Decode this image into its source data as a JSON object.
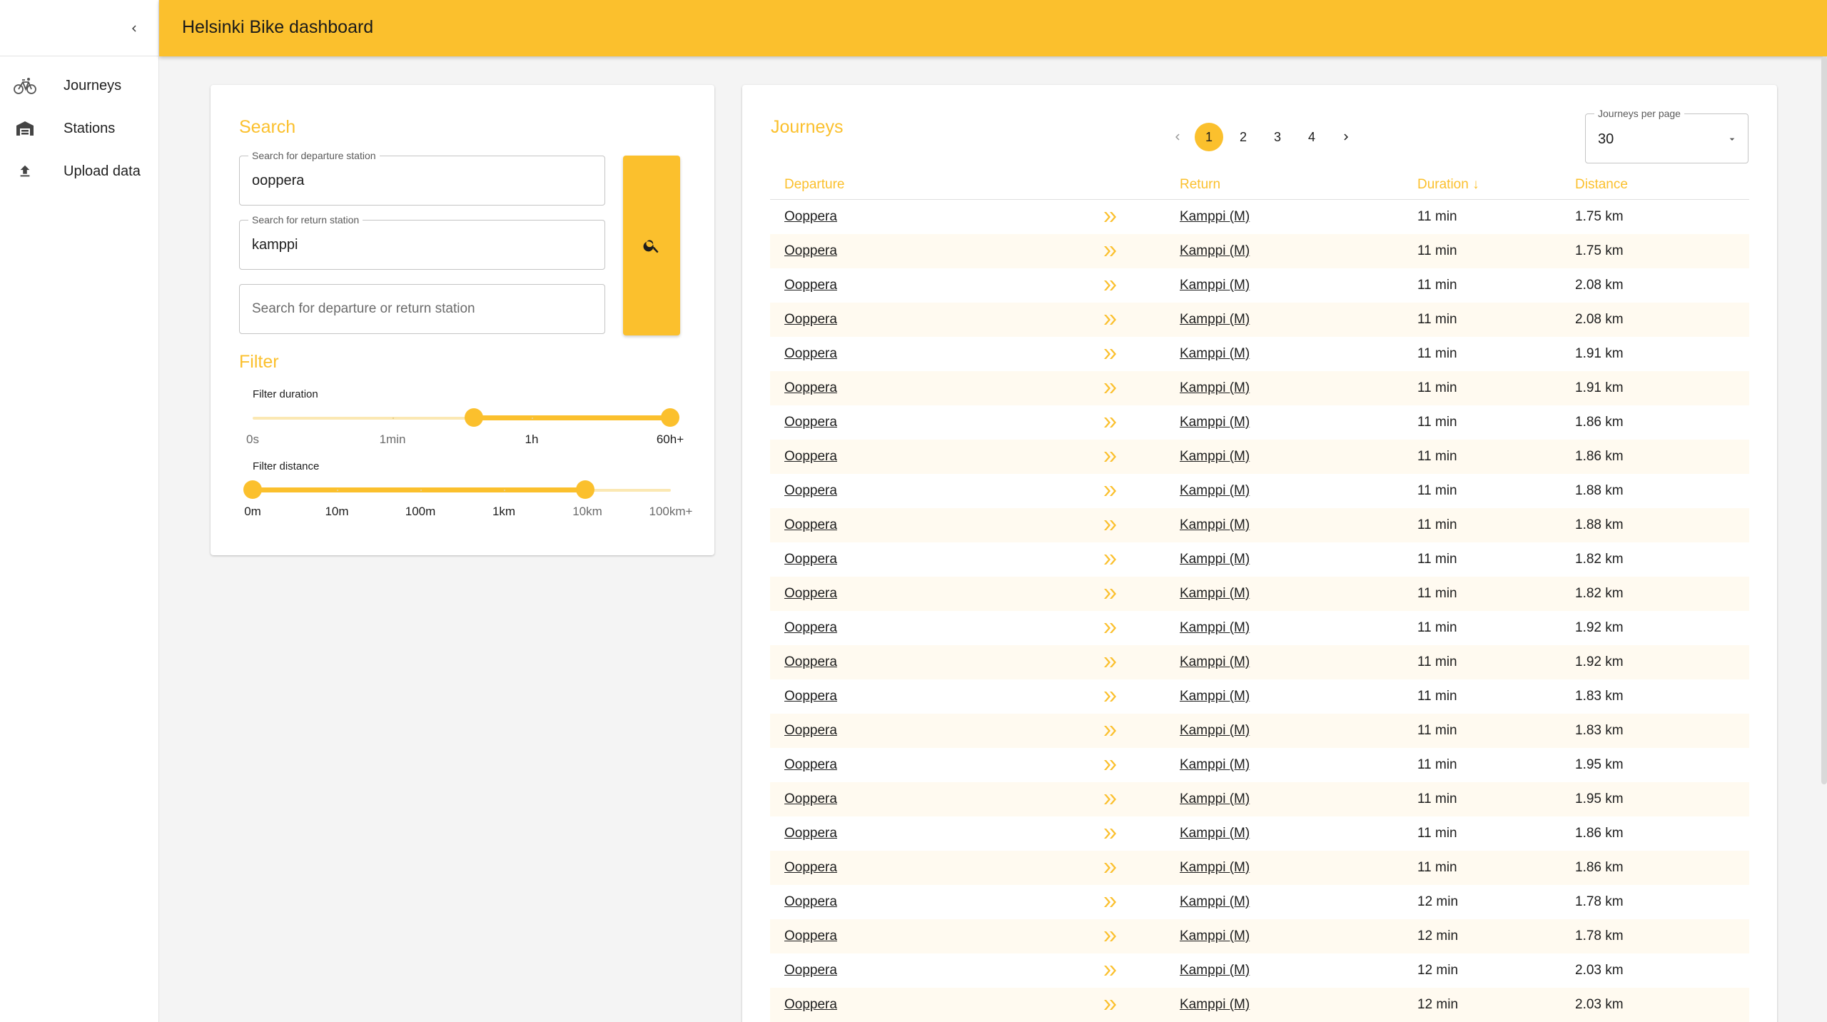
{
  "app": {
    "title": "Helsinki Bike dashboard"
  },
  "sidebar": {
    "collapse_icon": "chevron-left-icon",
    "items": [
      {
        "label": "Journeys",
        "icon": "bicycle-icon"
      },
      {
        "label": "Stations",
        "icon": "warehouse-icon"
      },
      {
        "label": "Upload data",
        "icon": "upload-icon"
      }
    ]
  },
  "search": {
    "title": "Search",
    "departure": {
      "legend": "Search for departure station",
      "value": "ooppera"
    },
    "return": {
      "legend": "Search for return station",
      "value": "kamppi"
    },
    "either": {
      "placeholder": "Search for departure or return station"
    },
    "button_icon": "search-icon"
  },
  "filter": {
    "title": "Filter",
    "duration": {
      "label": "Filter duration",
      "marks": [
        "0s",
        "1min",
        "1h",
        "60h+"
      ],
      "selected_range": [
        "1h (approx. 0.5 of scale)",
        "60h+"
      ]
    },
    "distance": {
      "label": "Filter distance",
      "marks": [
        "0m",
        "10m",
        "100m",
        "1km",
        "10km",
        "100km+"
      ],
      "selected_range": [
        "0m",
        "10km"
      ]
    }
  },
  "journeys": {
    "title": "Journeys",
    "pagination": {
      "pages": [
        "1",
        "2",
        "3",
        "4"
      ],
      "current": "1"
    },
    "per_page": {
      "legend": "Journeys per page",
      "value": "30"
    },
    "columns": {
      "departure": "Departure",
      "return": "Return",
      "duration": "Duration ↓",
      "distance": "Distance"
    },
    "rows": [
      {
        "departure": "Ooppera",
        "return": "Kamppi (M)",
        "duration": "11 min",
        "distance": "1.75 km"
      },
      {
        "departure": "Ooppera",
        "return": "Kamppi (M)",
        "duration": "11 min",
        "distance": "1.75 km"
      },
      {
        "departure": "Ooppera",
        "return": "Kamppi (M)",
        "duration": "11 min",
        "distance": "2.08 km"
      },
      {
        "departure": "Ooppera",
        "return": "Kamppi (M)",
        "duration": "11 min",
        "distance": "2.08 km"
      },
      {
        "departure": "Ooppera",
        "return": "Kamppi (M)",
        "duration": "11 min",
        "distance": "1.91 km"
      },
      {
        "departure": "Ooppera",
        "return": "Kamppi (M)",
        "duration": "11 min",
        "distance": "1.91 km"
      },
      {
        "departure": "Ooppera",
        "return": "Kamppi (M)",
        "duration": "11 min",
        "distance": "1.86 km"
      },
      {
        "departure": "Ooppera",
        "return": "Kamppi (M)",
        "duration": "11 min",
        "distance": "1.86 km"
      },
      {
        "departure": "Ooppera",
        "return": "Kamppi (M)",
        "duration": "11 min",
        "distance": "1.88 km"
      },
      {
        "departure": "Ooppera",
        "return": "Kamppi (M)",
        "duration": "11 min",
        "distance": "1.88 km"
      },
      {
        "departure": "Ooppera",
        "return": "Kamppi (M)",
        "duration": "11 min",
        "distance": "1.82 km"
      },
      {
        "departure": "Ooppera",
        "return": "Kamppi (M)",
        "duration": "11 min",
        "distance": "1.82 km"
      },
      {
        "departure": "Ooppera",
        "return": "Kamppi (M)",
        "duration": "11 min",
        "distance": "1.92 km"
      },
      {
        "departure": "Ooppera",
        "return": "Kamppi (M)",
        "duration": "11 min",
        "distance": "1.92 km"
      },
      {
        "departure": "Ooppera",
        "return": "Kamppi (M)",
        "duration": "11 min",
        "distance": "1.83 km"
      },
      {
        "departure": "Ooppera",
        "return": "Kamppi (M)",
        "duration": "11 min",
        "distance": "1.83 km"
      },
      {
        "departure": "Ooppera",
        "return": "Kamppi (M)",
        "duration": "11 min",
        "distance": "1.95 km"
      },
      {
        "departure": "Ooppera",
        "return": "Kamppi (M)",
        "duration": "11 min",
        "distance": "1.95 km"
      },
      {
        "departure": "Ooppera",
        "return": "Kamppi (M)",
        "duration": "11 min",
        "distance": "1.86 km"
      },
      {
        "departure": "Ooppera",
        "return": "Kamppi (M)",
        "duration": "11 min",
        "distance": "1.86 km"
      },
      {
        "departure": "Ooppera",
        "return": "Kamppi (M)",
        "duration": "12 min",
        "distance": "1.78 km"
      },
      {
        "departure": "Ooppera",
        "return": "Kamppi (M)",
        "duration": "12 min",
        "distance": "1.78 km"
      },
      {
        "departure": "Ooppera",
        "return": "Kamppi (M)",
        "duration": "12 min",
        "distance": "2.03 km"
      },
      {
        "departure": "Ooppera",
        "return": "Kamppi (M)",
        "duration": "12 min",
        "distance": "2.03 km"
      }
    ],
    "row_arrow_icon": "double-chevron-right-icon"
  },
  "colors": {
    "accent": "#fbc02d",
    "row_alt": "#fffaf0",
    "track": "#fbe8b3"
  }
}
